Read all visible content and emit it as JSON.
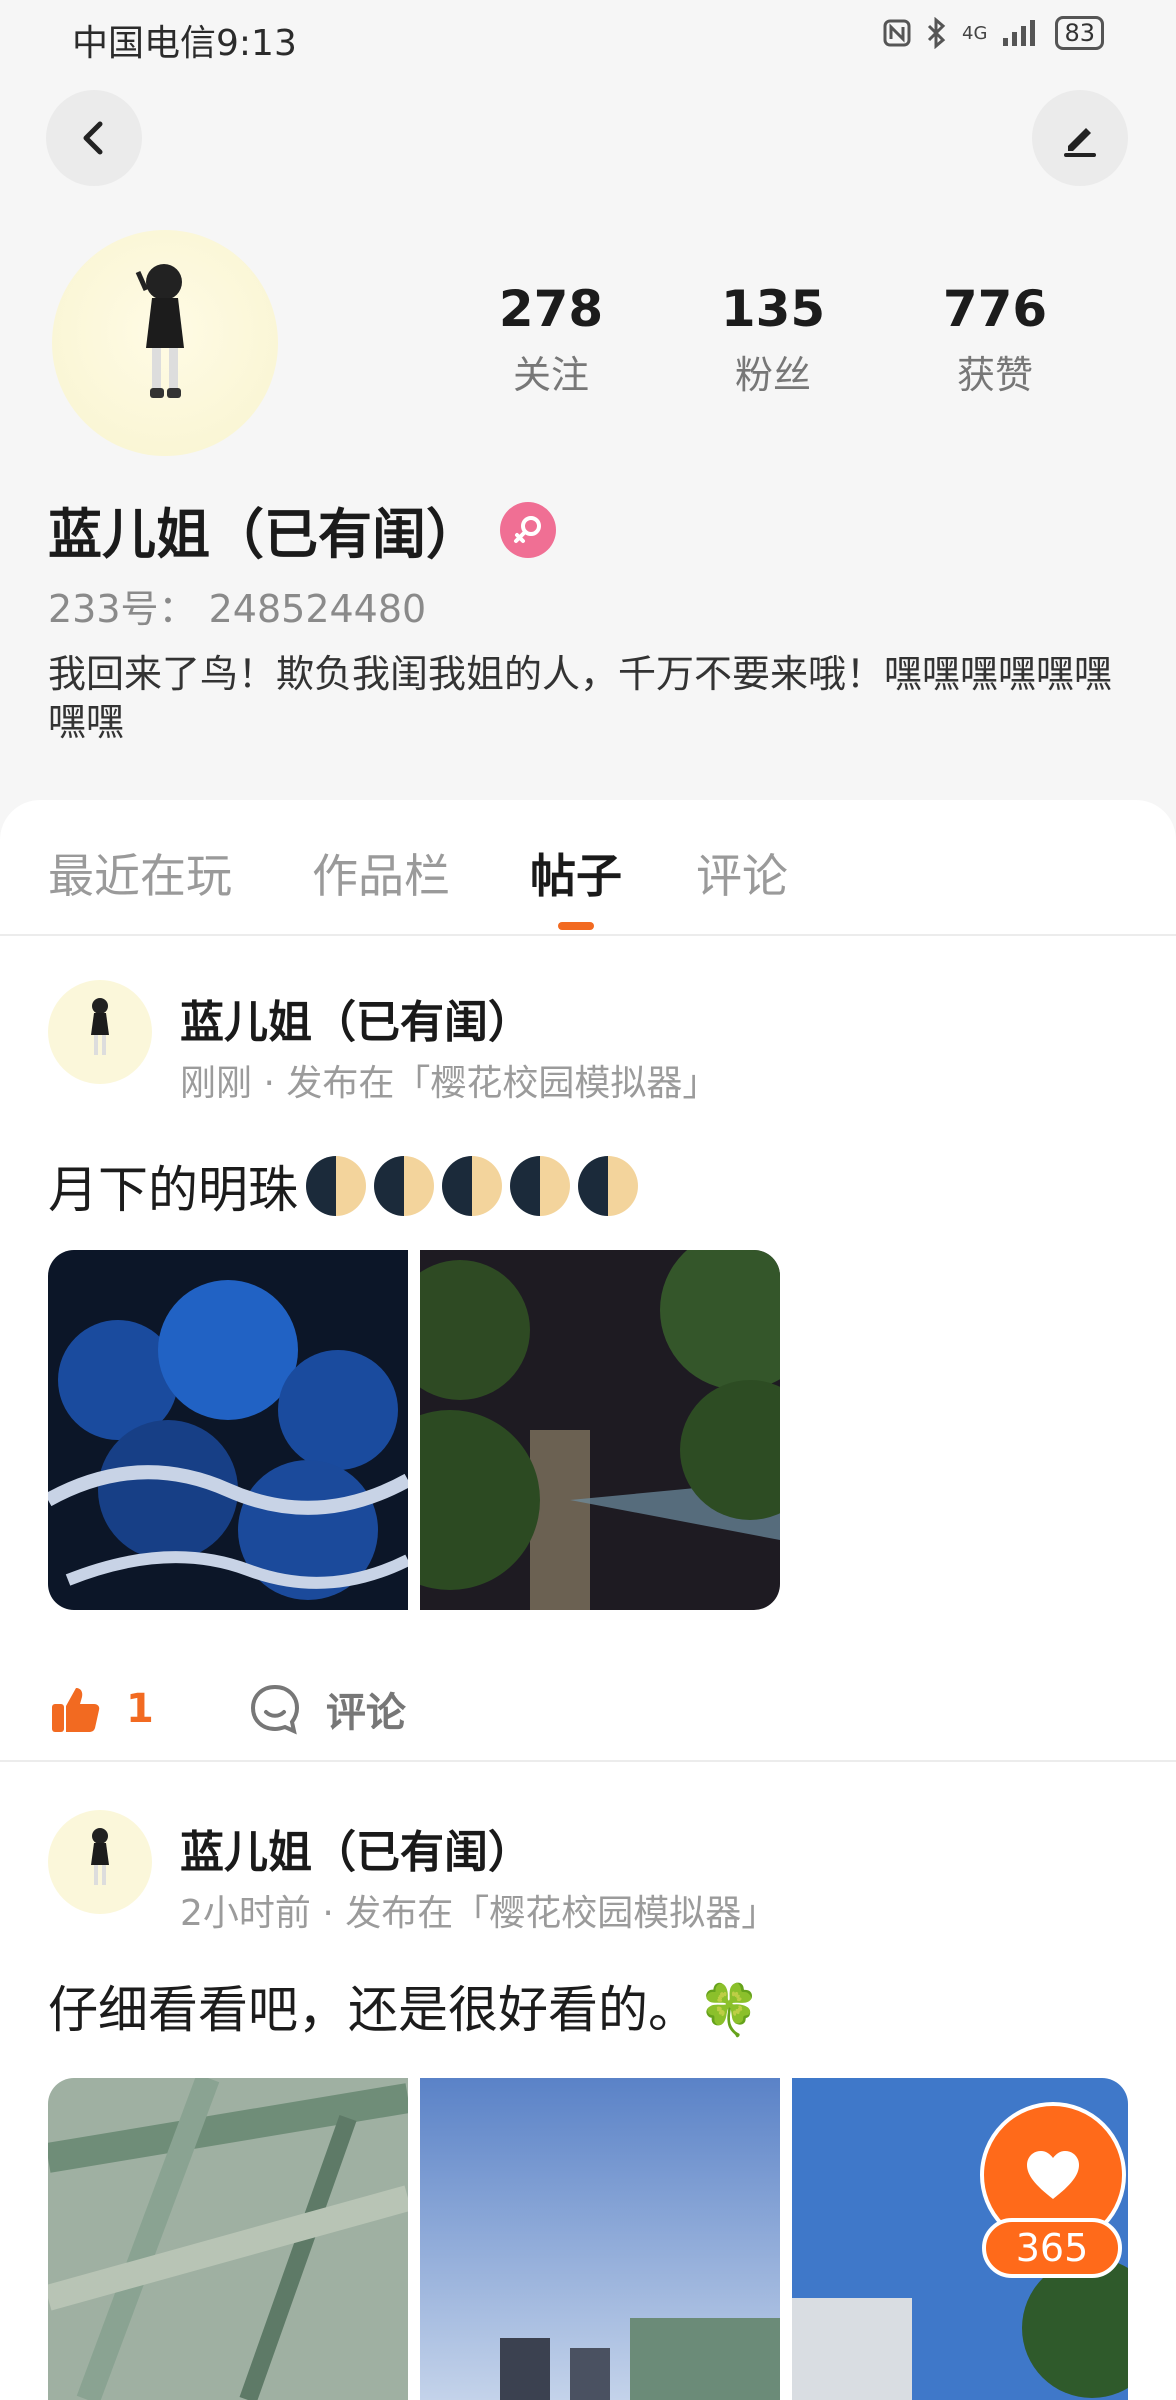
{
  "status_bar": {
    "carrier_time": "中国电信9:13",
    "network": "4G",
    "battery": "83"
  },
  "profile": {
    "stats": [
      {
        "value": "278",
        "label": "关注"
      },
      {
        "value": "135",
        "label": "粉丝"
      },
      {
        "value": "776",
        "label": "获赞"
      }
    ],
    "name": "蓝儿姐（已有闺）",
    "uid": "233号：  248524480",
    "bio": "我回来了鸟！欺负我闺我姐的人，千万不要来哦！嘿嘿嘿嘿嘿嘿嘿嘿"
  },
  "tabs": [
    {
      "label": "最近在玩"
    },
    {
      "label": "作品栏"
    },
    {
      "label": "帖子"
    },
    {
      "label": "评论"
    }
  ],
  "active_tab": "帖子",
  "posts": [
    {
      "author": "蓝儿姐（已有闺）",
      "meta": "刚刚 · 发布在「樱花校园模拟器」",
      "text": "月下的明珠",
      "likes": "1",
      "comment_label": "评论"
    },
    {
      "author": "蓝儿姐（已有闺）",
      "meta": "2小时前 · 发布在「樱花校园模拟器」",
      "text": "仔细看看吧，还是很好看的。🍀"
    }
  ],
  "floating_like": {
    "count": "365"
  },
  "colors": {
    "accent": "#f26a21",
    "fab": "#ff6a1a",
    "gender": "#f06f94"
  }
}
